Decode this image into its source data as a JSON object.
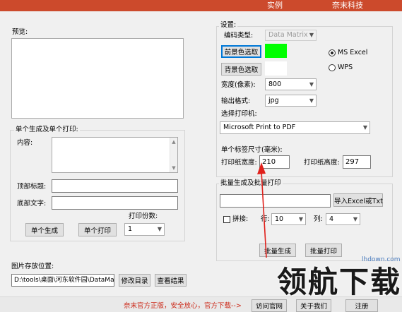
{
  "topbar": {
    "item1": "实例",
    "item2": "奈末科技",
    "color": "#cc4a2c"
  },
  "preview": {
    "label": "预览:"
  },
  "single": {
    "group_title": "单个生成及单个打印:",
    "content_label": "内容:",
    "top_title_label": "顶部标题:",
    "bottom_text_label": "底部文字:",
    "copies_label": "打印份数:",
    "generate_button": "单个生成",
    "print_button": "单个打印",
    "copies_value": "1"
  },
  "settings": {
    "group_title": "设置:",
    "encoding_label": "编码类型:",
    "encoding_value": "Data Matrix",
    "fg_button": "前景色选取",
    "fg_color": "#00ff00",
    "bg_button": "背景色选取",
    "bg_color": "#ffffff",
    "ms_excel_label": "MS  Excel",
    "wps_label": "WPS",
    "width_label": "宽度(像素):",
    "width_value": "800",
    "format_label": "输出格式:",
    "format_value": "jpg",
    "printer_label": "选择打印机:",
    "printer_value": "Microsoft Print to PDF",
    "label_size_label": "单个标签尺寸(毫米):",
    "paper_width_label": "打印纸宽度:",
    "paper_width_value": "210",
    "paper_height_label": "打印纸高度:",
    "paper_height_value": "297"
  },
  "batch": {
    "group_title": "批量生成及批量打印",
    "import_button": "导入Excel或Txt",
    "stitch_label": "拼接:",
    "row_label": "行:",
    "row_value": "10",
    "col_label": "列:",
    "col_value": "4",
    "generate_button": "批量生成",
    "print_button": "批量打印"
  },
  "storage": {
    "label": "图片存放位置:",
    "path_value": "D:\\tools\\桌面\\河东软件园\\DataMa",
    "modify_button": "修改目录",
    "view_button": "查看结果"
  },
  "footer": {
    "notice": "奈末官方正版，安全放心，官方下载-->",
    "visit_button": "访问官网",
    "about_button": "关于我们",
    "register_button": "注册",
    "notice_color": "#cc2a1a"
  },
  "watermark": {
    "big": "领航下载",
    "small": "lhdown.com"
  }
}
